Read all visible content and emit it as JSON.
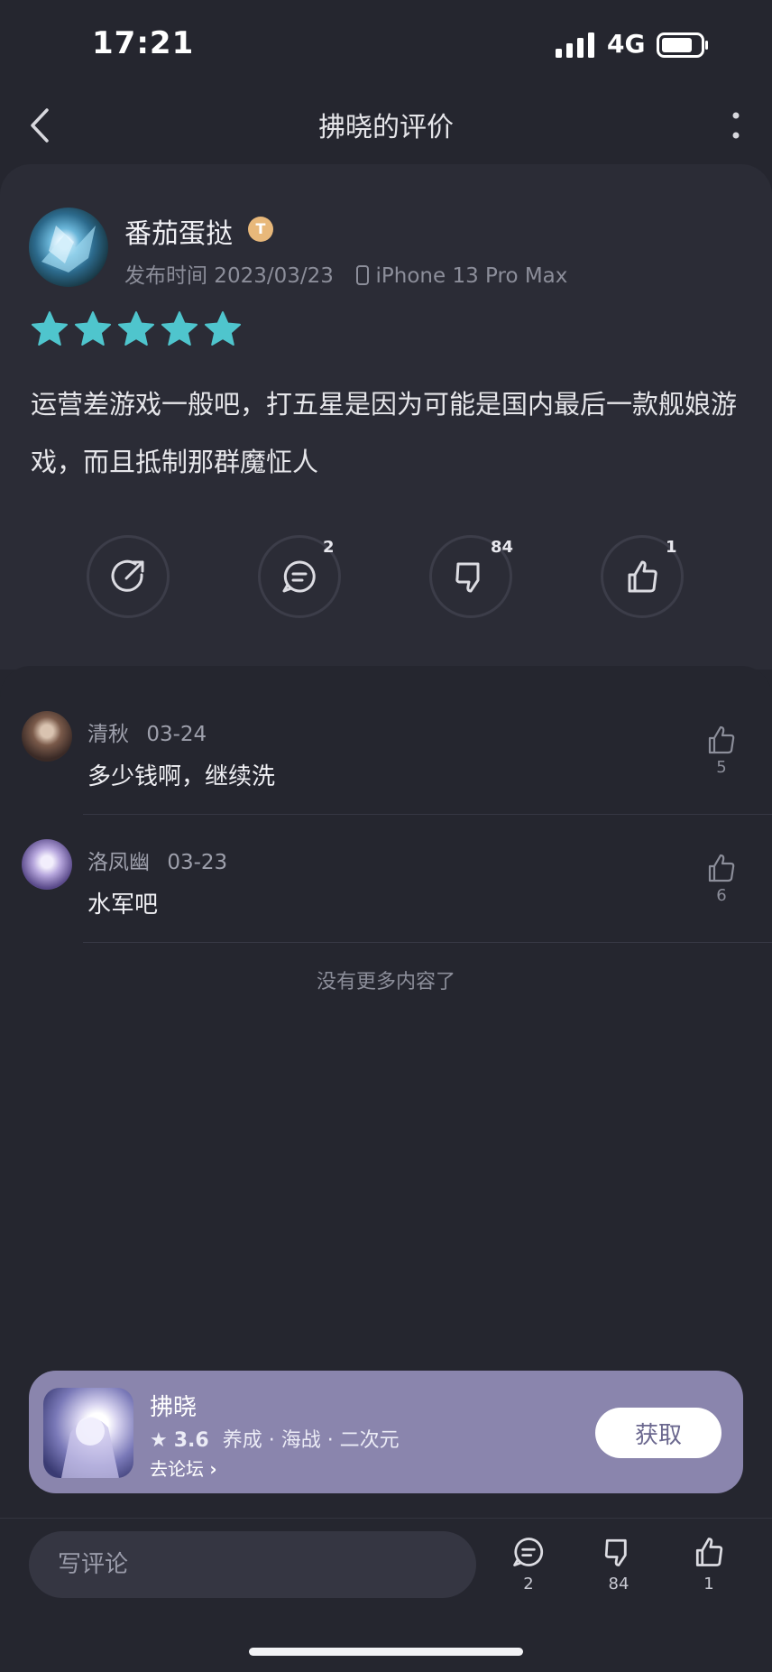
{
  "status_bar": {
    "time": "17:21",
    "network": "4G"
  },
  "header": {
    "title": "拂晓的评价"
  },
  "review": {
    "username": "番茄蛋挞",
    "badge": "T",
    "publish_label": "发布时间 2023/03/23",
    "device": "iPhone 13 Pro Max",
    "rating": 5,
    "text": "运营差游戏一般吧，打五星是因为可能是国内最后一款舰娘游戏，而且抵制那群魔怔人",
    "actions": {
      "comments": "2",
      "dislikes": "84",
      "likes": "1"
    }
  },
  "comments": [
    {
      "user": "清秋",
      "date": "03-24",
      "text": "多少钱啊，继续洗",
      "likes": "5"
    },
    {
      "user": "洛凤幽",
      "date": "03-23",
      "text": "水军吧",
      "likes": "6"
    }
  ],
  "no_more_text": "没有更多内容了",
  "app": {
    "name": "拂晓",
    "rating": "3.6",
    "tags": "养成 · 海战 · 二次元",
    "forum_link": "去论坛",
    "get_label": "获取"
  },
  "bottom_bar": {
    "placeholder": "写评论",
    "comments": "2",
    "dislikes": "84",
    "likes": "1"
  },
  "colors": {
    "star": "#4fc5cd",
    "background": "#25262f",
    "card": "#2b2c36",
    "banner": "#8a85ad"
  }
}
